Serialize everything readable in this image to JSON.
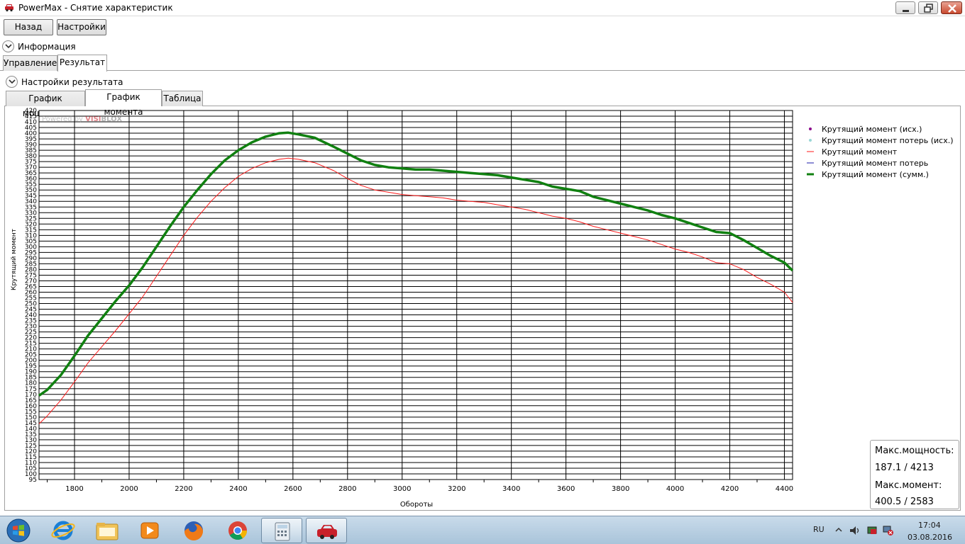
{
  "window": {
    "title": "PowerMax - Снятие характеристик",
    "app_icon": "car-icon",
    "controls": {
      "minimize": "minimize-icon",
      "maximize": "maximize-icon",
      "close": "close-icon"
    }
  },
  "toolbar": {
    "back_label": "Назад",
    "settings_label": "Настройки"
  },
  "info_expander": {
    "label": "Информация",
    "icon": "chevron-down-icon"
  },
  "main_tabs": [
    {
      "label": "Управление"
    },
    {
      "label": "Результат",
      "active": true
    }
  ],
  "result_settings": {
    "label": "Настройки результата",
    "icon": "chevron-down-icon"
  },
  "chart_tabs": [
    {
      "label": "График мощности"
    },
    {
      "label": "График момента",
      "active": true
    },
    {
      "label": "Таблица"
    }
  ],
  "chart": {
    "watermark_prefix": "Powered by ",
    "watermark_brand_a": "VISI",
    "watermark_brand_b": "BLOX"
  },
  "chart_data": {
    "type": "line",
    "xlabel": "Обороты",
    "ylabel": "Крутящий момент",
    "xlim": [
      1670,
      4430
    ],
    "ylim": [
      95,
      420
    ],
    "x_ticks": [
      1800,
      2000,
      2200,
      2400,
      2600,
      2800,
      3000,
      3200,
      3400,
      3600,
      3800,
      4000,
      4200,
      4400
    ],
    "y_ticks_from": 95,
    "y_ticks_to": 420,
    "y_tick_step": 5,
    "grid": true,
    "legend_position": "right",
    "legend": [
      {
        "name": "Крутящий момент (исх.)",
        "marker": "dot",
        "color": "#8b0a8b"
      },
      {
        "name": "Крутящий момент потерь (исх.)",
        "marker": "dot",
        "color": "#9ad6d6"
      },
      {
        "name": "Крутящий момент",
        "marker": "line",
        "color": "#ff1a1a"
      },
      {
        "name": "Крутящий момент потерь",
        "marker": "line",
        "color": "#1b1ba8"
      },
      {
        "name": "Крутящий момент (сумм.)",
        "marker": "line-thick",
        "color": "#108010"
      }
    ],
    "series": [
      {
        "name": "Крутящий момент (сумм.)",
        "color": "#108010",
        "x": [
          1670,
          1700,
          1750,
          1800,
          1850,
          1900,
          1950,
          2000,
          2050,
          2100,
          2150,
          2200,
          2250,
          2300,
          2350,
          2400,
          2450,
          2500,
          2550,
          2583,
          2620,
          2680,
          2750,
          2800,
          2850,
          2900,
          2950,
          3000,
          3050,
          3100,
          3150,
          3200,
          3250,
          3300,
          3350,
          3400,
          3450,
          3500,
          3550,
          3600,
          3650,
          3700,
          3750,
          3800,
          3850,
          3900,
          3950,
          4000,
          4050,
          4100,
          4150,
          4200,
          4250,
          4300,
          4350,
          4400,
          4430
        ],
        "values": [
          169,
          174,
          187,
          204,
          222,
          237,
          252,
          266,
          282,
          300,
          318,
          335,
          350,
          364,
          376,
          385,
          392,
          397,
          400,
          400.5,
          399,
          396,
          388,
          382,
          376,
          372,
          370,
          369,
          368,
          368,
          367,
          366,
          365,
          364,
          363,
          361,
          359,
          357,
          353,
          351,
          349,
          344,
          341,
          338,
          335,
          332,
          328,
          325,
          321,
          317,
          313,
          312,
          306,
          299,
          292,
          286,
          279
        ]
      },
      {
        "name": "Крутящий момент",
        "color": "#ff1a1a",
        "x": [
          1670,
          1700,
          1750,
          1800,
          1850,
          1900,
          1950,
          2000,
          2050,
          2100,
          2150,
          2200,
          2250,
          2300,
          2350,
          2400,
          2450,
          2500,
          2550,
          2583,
          2620,
          2680,
          2750,
          2800,
          2850,
          2900,
          2950,
          3000,
          3050,
          3100,
          3150,
          3200,
          3250,
          3300,
          3350,
          3400,
          3450,
          3500,
          3550,
          3600,
          3650,
          3700,
          3750,
          3800,
          3850,
          3900,
          3950,
          4000,
          4050,
          4100,
          4150,
          4200,
          4250,
          4300,
          4350,
          4400,
          4430
        ],
        "values": [
          144,
          151,
          165,
          181,
          198,
          212,
          226,
          241,
          256,
          274,
          292,
          310,
          326,
          340,
          352,
          362,
          369,
          374,
          377,
          378,
          377,
          374,
          367,
          360,
          354,
          350,
          348,
          346,
          345,
          344,
          343,
          341,
          340,
          339,
          337,
          335,
          333,
          330,
          327,
          325,
          322,
          318,
          315,
          312,
          309,
          306,
          302,
          298,
          295,
          291,
          286,
          285,
          280,
          273,
          267,
          260,
          251
        ]
      }
    ]
  },
  "stats": {
    "max_power_label": "Макс.мощность:",
    "max_power_value": "187.1 / 4213",
    "max_torque_label": "Макс.момент:",
    "max_torque_value": "400.5 / 2583"
  },
  "taskbar": {
    "items": [
      "ie-icon",
      "folder-icon",
      "media-player-icon",
      "firefox-icon",
      "chrome-icon",
      "calculator-icon",
      "powermax-car-icon"
    ],
    "language": "RU",
    "time": "17:04",
    "date": "03.08.2016"
  }
}
